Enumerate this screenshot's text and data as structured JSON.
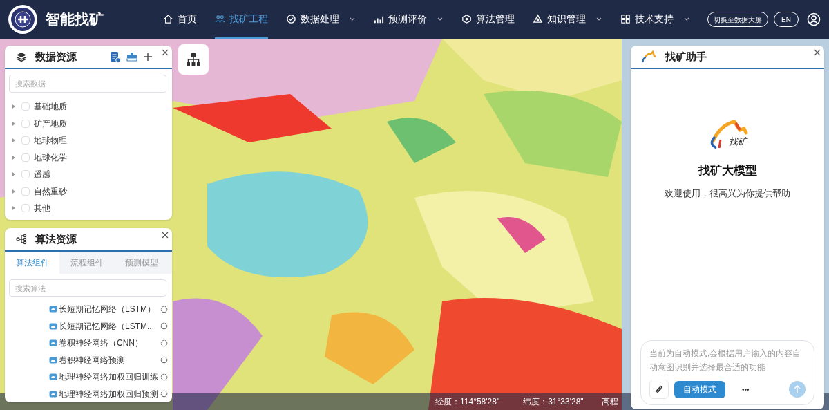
{
  "header": {
    "app_title": "智能找矿",
    "nav": [
      {
        "label": "首页",
        "selected": false,
        "dropdown": false
      },
      {
        "label": "找矿工程",
        "selected": true,
        "dropdown": false
      },
      {
        "label": "数据处理",
        "selected": false,
        "dropdown": true
      },
      {
        "label": "预测评价",
        "selected": false,
        "dropdown": true
      },
      {
        "label": "算法管理",
        "selected": false,
        "dropdown": false
      },
      {
        "label": "知识管理",
        "selected": false,
        "dropdown": true
      },
      {
        "label": "技术支持",
        "selected": false,
        "dropdown": true
      }
    ],
    "switch_button": "切换至数据大屏",
    "language_button": "EN"
  },
  "data_panel": {
    "title": "数据资源",
    "search": {
      "placeholder": "搜索数据"
    },
    "items": [
      {
        "label": "基础地质",
        "checked": false
      },
      {
        "label": "矿产地质",
        "checked": false
      },
      {
        "label": "地球物理",
        "checked": false
      },
      {
        "label": "地球化学",
        "checked": false
      },
      {
        "label": "遥感",
        "checked": false
      },
      {
        "label": "自然重砂",
        "checked": false
      },
      {
        "label": "其他",
        "checked": false
      }
    ]
  },
  "algorithm_panel": {
    "title": "算法资源",
    "tabs": [
      {
        "label": "算法组件",
        "selected": true
      },
      {
        "label": "流程组件",
        "selected": false
      },
      {
        "label": "预测模型",
        "selected": false
      }
    ],
    "search": {
      "placeholder": "搜索算法"
    },
    "items": [
      "长短期记忆网络（LSTM）",
      "长短期记忆网络（LSTM...",
      "卷积神经网络（CNN）",
      "卷积神经网络预测",
      "地理神经网络加权回归训练",
      "地理神经网络加权回归预测"
    ]
  },
  "assistant": {
    "title": "找矿助手",
    "logo_text": "找矿",
    "model_name": "找矿大模型",
    "welcome": "欢迎使用，很高兴为你提供帮助",
    "input": {
      "placeholder": "当前为自动模式,会根据用户输入的内容自动意图识别并选择最合适的功能"
    },
    "mode_button": "自动模式",
    "more_button": "•••"
  },
  "status_bar": {
    "longitude": "经度：114°58'28\"",
    "latitude": "纬度：31°33'28\"",
    "elevation": "高程"
  }
}
